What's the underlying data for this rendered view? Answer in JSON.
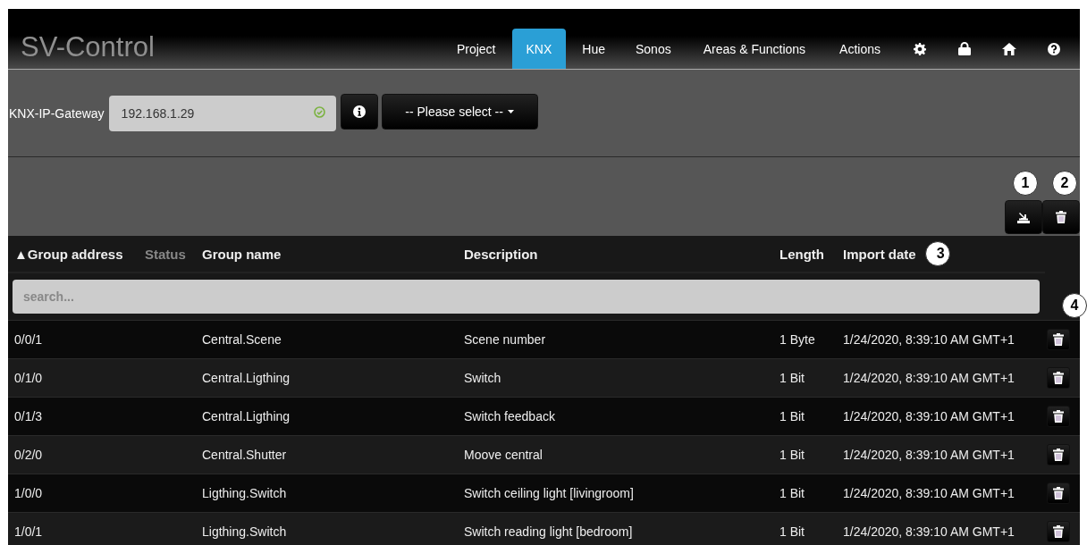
{
  "navbar": {
    "logo": "SV-Control",
    "tabs": [
      {
        "label": "Project",
        "selected": false
      },
      {
        "label": "KNX",
        "selected": true
      },
      {
        "label": "Hue",
        "selected": false
      },
      {
        "label": "Sonos",
        "selected": false
      },
      {
        "label": "Areas & Functions",
        "selected": false
      },
      {
        "label": "Actions",
        "selected": false
      }
    ],
    "icons": [
      {
        "kind": "settings"
      },
      {
        "kind": "lock"
      },
      {
        "kind": "home"
      },
      {
        "kind": "help"
      }
    ]
  },
  "gateway": {
    "label": "KNX-IP-Gateway",
    "value": "192.168.1.29",
    "valid": true,
    "dropdown": "-- Please select --"
  },
  "toolbar": {
    "buttons": [
      {
        "kind": "import",
        "callout": "1"
      },
      {
        "kind": "delete",
        "callout": "2"
      }
    ]
  },
  "table": {
    "columns": [
      {
        "label": "▲Group address",
        "disabled": false
      },
      {
        "label": "Status",
        "disabled": true
      },
      {
        "label": "Group name",
        "disabled": false
      },
      {
        "label": "Description",
        "disabled": false
      },
      {
        "label": "Length",
        "disabled": false
      },
      {
        "label": "Import date",
        "disabled": false,
        "callout": "3"
      }
    ],
    "delete_callout": "4",
    "search": {
      "placeholder": "search..."
    },
    "rows": [
      {
        "address": "0/0/1",
        "group_name": "Central.Scene",
        "description": "Scene number",
        "length": "1 Byte",
        "import_date": "1/24/2020, 8:39:10 AM GMT+1"
      },
      {
        "address": "0/1/0",
        "group_name": "Central.Ligthing",
        "description": "Switch",
        "length": "1 Bit",
        "import_date": "1/24/2020, 8:39:10 AM GMT+1"
      },
      {
        "address": "0/1/3",
        "group_name": "Central.Ligthing",
        "description": "Switch feedback",
        "length": "1 Bit",
        "import_date": "1/24/2020, 8:39:10 AM GMT+1"
      },
      {
        "address": "0/2/0",
        "group_name": "Central.Shutter",
        "description": "Moove central",
        "length": "1 Bit",
        "import_date": "1/24/2020, 8:39:10 AM GMT+1"
      },
      {
        "address": "1/0/0",
        "group_name": "Ligthing.Switch",
        "description": "Switch ceiling light [livingroom]",
        "length": "1 Bit",
        "import_date": "1/24/2020, 8:39:10 AM GMT+1"
      },
      {
        "address": "1/0/1",
        "group_name": "Ligthing.Switch",
        "description": "Switch reading light [bedroom]",
        "length": "1 Bit",
        "import_date": "1/24/2020, 8:39:10 AM GMT+1"
      }
    ]
  }
}
